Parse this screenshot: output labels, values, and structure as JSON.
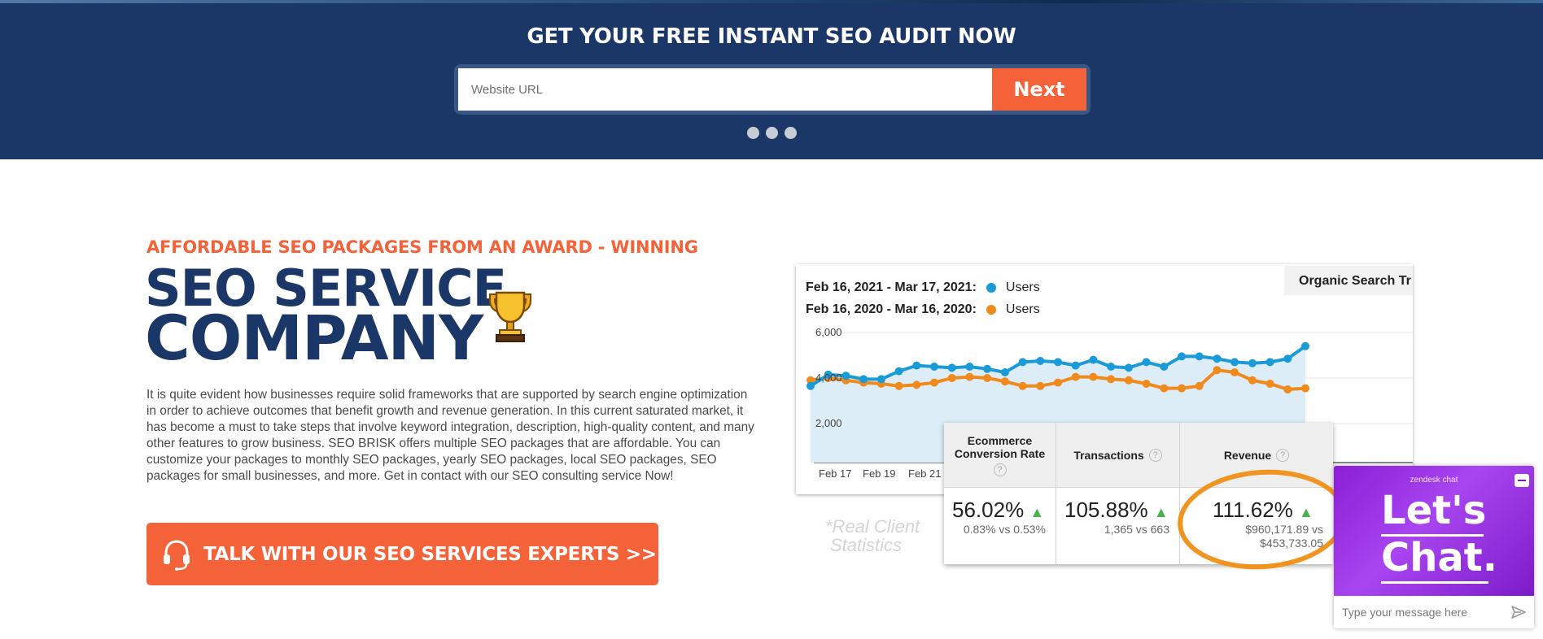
{
  "banner": {
    "title": "GET YOUR FREE INSTANT SEO AUDIT NOW",
    "url_placeholder": "Website URL",
    "next_label": "Next"
  },
  "hero": {
    "eyebrow": "AFFORDABLE SEO PACKAGES FROM AN AWARD - WINNING",
    "headline_line1": "SEO SERVICE",
    "headline_line2": "COMPANY",
    "body": "It is quite evident how businesses require solid frameworks that are supported by search engine optimization in order to achieve outcomes that benefit growth and revenue generation. In this current saturated market, it has become a must to take steps that involve keyword integration, description, high-quality content, and many other features to grow business. SEO BRISK offers multiple SEO packages that are affordable. You can customize your packages to monthly SEO packages, yearly SEO packages, local SEO packages, SEO packages for small businesses, and more. Get in contact with our SEO consulting service Now!",
    "cta_label": "TALK WITH OUR SEO SERVICES EXPERTS >>"
  },
  "stats": {
    "legend": [
      {
        "range": "Feb 16, 2021 - Mar 17, 2021:",
        "label": "Users",
        "color": "#1a9bd7"
      },
      {
        "range": "Feb 16, 2020 - Mar 16, 2020:",
        "label": "Users",
        "color": "#f08a1c"
      }
    ],
    "organic_label": "Organic Search Tr",
    "y_ticks": [
      "6,000",
      "4,000",
      "2,000"
    ],
    "x_ticks": [
      "Feb 17",
      "Feb 19",
      "Feb 21"
    ],
    "metrics": [
      {
        "header": "Ecommerce Conversion Rate",
        "value": "56.02%",
        "sub": "0.83% vs 0.53%"
      },
      {
        "header": "Transactions",
        "value": "105.88%",
        "sub": "1,365 vs 663"
      },
      {
        "header": "Revenue",
        "value": "111.62%",
        "sub_line1": "$960,171.89 vs",
        "sub_line2": "$453,733.05"
      }
    ],
    "help_glyph": "?",
    "up_glyph": "▲",
    "caption_line1": "*Real Client",
    "caption_line2": "Statistics",
    "chart_data": {
      "type": "line",
      "ylim": [
        0,
        6000
      ],
      "series": [
        {
          "name": "Feb 16, 2021 - Mar 17, 2021: Users",
          "values": [
            3650,
            4150,
            4100,
            3950,
            3950,
            4300,
            4550,
            4500,
            4450,
            4500,
            4400,
            4250,
            4700,
            4750,
            4700,
            4550,
            4800,
            4500,
            4450,
            4700,
            4500,
            4950,
            4950,
            4850,
            4700,
            4650,
            4700,
            4850,
            5400
          ]
        },
        {
          "name": "Feb 16, 2020 - Mar 16, 2020: Users",
          "values": [
            3900,
            4000,
            3900,
            3800,
            3750,
            3650,
            3700,
            3800,
            4000,
            4050,
            4000,
            3850,
            3650,
            3650,
            3800,
            4050,
            4050,
            3950,
            3900,
            3750,
            3550,
            3550,
            3650,
            4350,
            4250,
            3900,
            3750,
            3500,
            3550
          ]
        }
      ],
      "colors": [
        "#1a9bd7",
        "#f08a1c"
      ]
    }
  },
  "chat": {
    "brand": "zendesk chat",
    "headline_line1": "Let's",
    "headline_line2": "Chat.",
    "placeholder": "Type your message here"
  },
  "colors": {
    "navy": "#1b3767",
    "accent": "#f4623a",
    "chat_purple": "#8b1fd6"
  }
}
